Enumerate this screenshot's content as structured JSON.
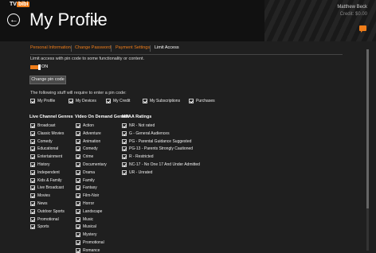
{
  "app": {
    "logo_tv": "TV",
    "logo_bibi": "bibi"
  },
  "header": {
    "title": "My Profile",
    "user_name": "Matthew Beck",
    "credit": "Credit: $0.00"
  },
  "tabs": [
    "Personal Information",
    "Change Password",
    "Payment Settings",
    "Limit Access"
  ],
  "limit": {
    "intro": "Limit access with pin code to some functionality or content.",
    "toggle_label": "ON",
    "change_pin": "Change pin code",
    "require_text": "The following stuff will require to enter a pin code:"
  },
  "require_items": [
    "My Profile",
    "My Devices",
    "My Credit",
    "My Subscriptions",
    "Purchases"
  ],
  "live_genres": {
    "heading": "Live Channel Genres",
    "items": [
      "Broadcast",
      "Classic Movies",
      "Comedy",
      "Educational",
      "Entertainment",
      "History",
      "Independent",
      "Kids & Family",
      "Live Broadcast",
      "Movies",
      "News",
      "Outdoor Sports",
      "Promotional",
      "Sports"
    ]
  },
  "vod_genres": {
    "heading": "Video On Demand Genres",
    "items": [
      "Action",
      "Adventure",
      "Animation",
      "Comedy",
      "Crime",
      "Documentary",
      "Drama",
      "Family",
      "Fantasy",
      "Film-Noir",
      "Horror",
      "Landscape",
      "Music",
      "Musical",
      "Mystery",
      "Promotional",
      "Romance"
    ]
  },
  "mpaa": {
    "heading": "MPAA Ratings",
    "items": [
      "NR - Not rated",
      "G - General Audiences",
      "PG - Parental Guidance Suggested",
      "PG-13 - Parents Strongly Cautioned",
      "R - Restricted",
      "NC-17 - No One 17 And Under Admitted",
      "UR - Unrated"
    ]
  },
  "colors": {
    "accent": "#f07d19",
    "background": "#1f1f1f"
  }
}
